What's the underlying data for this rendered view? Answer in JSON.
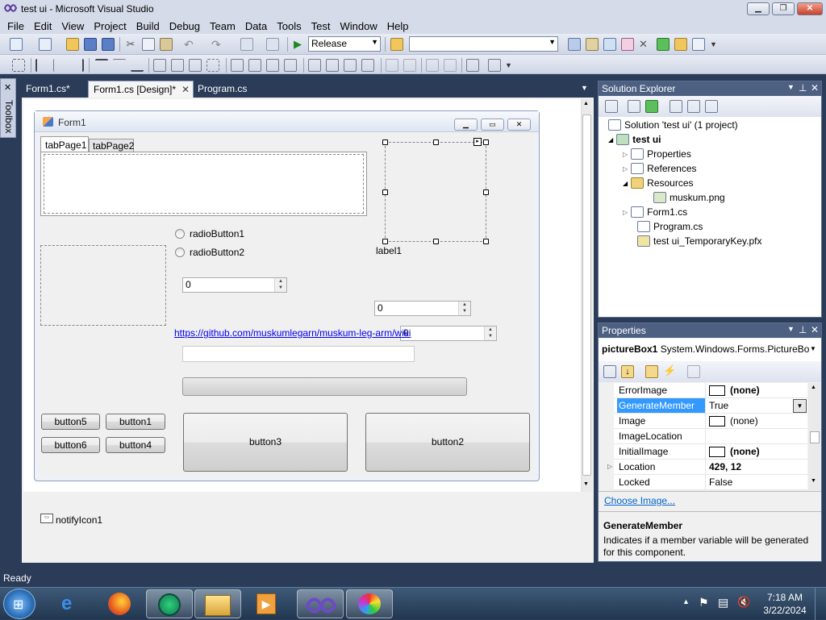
{
  "window": {
    "title": "test ui - Microsoft Visual Studio"
  },
  "menu": [
    "File",
    "Edit",
    "View",
    "Project",
    "Build",
    "Debug",
    "Team",
    "Data",
    "Tools",
    "Test",
    "Window",
    "Help"
  ],
  "toolbar": {
    "config_value": "Release",
    "platform_value": ""
  },
  "toolbox": {
    "label": "Toolbox"
  },
  "doc_tabs": [
    {
      "label": "Form1.cs*"
    },
    {
      "label": "Form1.cs [Design]*"
    },
    {
      "label": "Program.cs"
    }
  ],
  "form": {
    "title": "Form1",
    "tabs": [
      "tabPage1",
      "tabPage2"
    ],
    "radio1": "radioButton1",
    "radio2": "radioButton2",
    "label1": "label1",
    "numeric1": "0",
    "numeric2": "0",
    "numeric3": "0",
    "link": "https://github.com/muskumlegarn/muskum-leg-arm/wiki",
    "textbox": "",
    "progress": 0,
    "button5": "button5",
    "button1": "button1",
    "button6": "button6",
    "button4": "button4",
    "button3": "button3",
    "button2": "button2"
  },
  "tray_component": "notifyIcon1",
  "solution_explorer": {
    "title": "Solution Explorer",
    "items": [
      "Solution 'test ui' (1 project)",
      "test ui",
      "Properties",
      "References",
      "Resources",
      "muskum.png",
      "Form1.cs",
      "Program.cs",
      "test ui_TemporaryKey.pfx"
    ]
  },
  "properties": {
    "title": "Properties",
    "object_name": "pictureBox1",
    "object_type": "System.Windows.Forms.PictureBo",
    "rows": [
      {
        "name": "ErrorImage",
        "value": "(none)"
      },
      {
        "name": "GenerateMember",
        "value": "True"
      },
      {
        "name": "Image",
        "value": "(none)"
      },
      {
        "name": "ImageLocation",
        "value": ""
      },
      {
        "name": "InitialImage",
        "value": "(none)"
      },
      {
        "name": "Location",
        "value": "429, 12"
      },
      {
        "name": "Locked",
        "value": "False"
      }
    ],
    "link": "Choose Image...",
    "desc_title": "GenerateMember",
    "desc_text": "Indicates if a member variable will be generated for this component."
  },
  "status": {
    "text": "Ready"
  },
  "clock": {
    "time": "7:18 AM",
    "date": "3/22/2024"
  },
  "colors": {
    "panel_header": "#4d6082",
    "ide_bg": "#2b3c59",
    "selection": "#3399ff"
  }
}
